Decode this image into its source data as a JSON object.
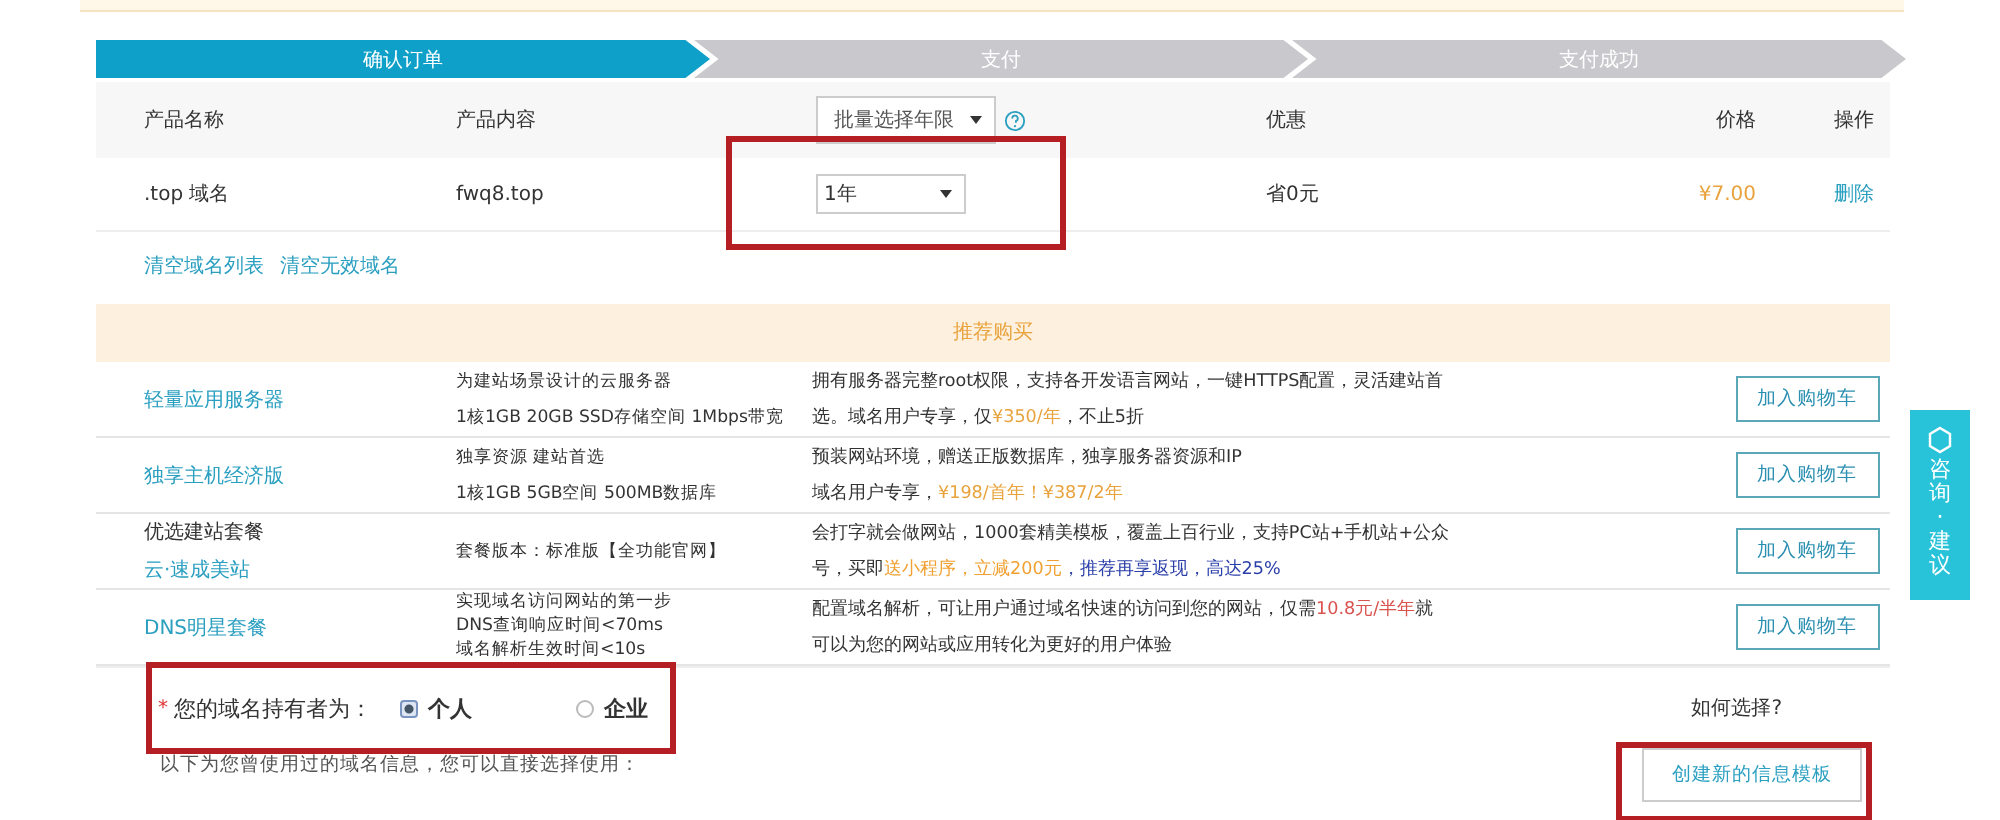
{
  "steps": [
    {
      "label": "确认订单",
      "selected": true
    },
    {
      "label": "支付",
      "selected": false
    },
    {
      "label": "支付成功",
      "selected": false
    }
  ],
  "table": {
    "columns": [
      {
        "label": "产品名称",
        "kind": "text"
      },
      {
        "label": "产品内容",
        "kind": "text"
      },
      {
        "label": "批量选择年限",
        "kind": "select"
      },
      {
        "label": "优惠",
        "kind": "text"
      },
      {
        "label": "价格",
        "kind": "price"
      },
      {
        "label": "操作",
        "kind": "action"
      }
    ],
    "rows": [
      {
        "name": ".top 域名",
        "content": "fwq8.top",
        "years": "1年",
        "discount": "省0元",
        "price": "¥7.00",
        "action": "删除"
      }
    ]
  },
  "links": [
    "清空域名列表",
    "清空无效域名"
  ],
  "recommend": {
    "title": "推荐购买",
    "items": [
      {
        "name_lines": [
          {
            "text": "轻量应用服务器",
            "kind": "link"
          }
        ],
        "spec_lines": [
          "为建站场景设计的云服务器",
          "1核1GB 20GB SSD存储空间 1Mbps带宽"
        ],
        "desc_lines": [
          [
            {
              "text": "拥有服务器完整root权限，支持各开发语言网站，一键HTTPS配置，灵活建站首",
              "kind": "plain"
            }
          ],
          [
            {
              "text": "选。域名用户专享，仅",
              "kind": "plain"
            },
            {
              "text": "¥350/年",
              "kind": "price"
            },
            {
              "text": "，不止5折",
              "kind": "plain"
            }
          ]
        ],
        "button": "加入购物车"
      },
      {
        "name_lines": [
          {
            "text": "独享主机经济版",
            "kind": "link"
          }
        ],
        "spec_lines": [
          "独享资源 建站首选",
          "1核1GB 5GB空间 500MB数据库"
        ],
        "desc_lines": [
          [
            {
              "text": "预装网站环境，赠送正版数据库，独享服务器资源和IP",
              "kind": "plain"
            }
          ],
          [
            {
              "text": "域名用户专享，",
              "kind": "plain"
            },
            {
              "text": "¥198/首年！¥387/2年",
              "kind": "price"
            }
          ]
        ],
        "button": "加入购物车"
      },
      {
        "name_lines": [
          {
            "text": "优选建站套餐",
            "kind": "plain"
          },
          {
            "text": "云·速成美站",
            "kind": "link"
          }
        ],
        "spec_lines": [
          "套餐版本：标准版【全功能官网】"
        ],
        "desc_lines": [
          [
            {
              "text": "会打字就会做网站，1000套精美模板，覆盖上百行业，支持PC站+手机站+公众",
              "kind": "plain"
            }
          ],
          [
            {
              "text": "号，买即",
              "kind": "plain"
            },
            {
              "text": "送小程序，立减200元",
              "kind": "promo"
            },
            {
              "text": "，推荐再享返现，高达25%",
              "kind": "blue"
            }
          ]
        ],
        "button": "加入购物车"
      },
      {
        "name_lines": [
          {
            "text": "DNS明星套餐",
            "kind": "link"
          }
        ],
        "spec_lines": [
          "实现域名访问网站的第一步",
          "DNS查询响应时间<70ms",
          "域名解析生效时间<10s"
        ],
        "desc_lines": [
          [
            {
              "text": "配置域名解析，可让用户通过域名快速的访问到您的网站，仅需",
              "kind": "plain"
            },
            {
              "text": "10.8元/半年",
              "kind": "red"
            },
            {
              "text": "就",
              "kind": "plain"
            }
          ],
          [
            {
              "text": "可以为您的网站或应用转化为更好的用户体验",
              "kind": "plain"
            }
          ]
        ],
        "button": "加入购物车"
      }
    ]
  },
  "owner": {
    "required_mark": "*",
    "label": "您的域名持有者为：",
    "options": [
      {
        "label": "个人",
        "selected": true
      },
      {
        "label": "企业",
        "selected": false
      }
    ],
    "note": "以下为您曾使用过的域名信息，您可以直接选择使用：",
    "help": "如何选择?",
    "create_button": "创建新的信息模板"
  },
  "consult": {
    "label": "咨询·建议"
  }
}
